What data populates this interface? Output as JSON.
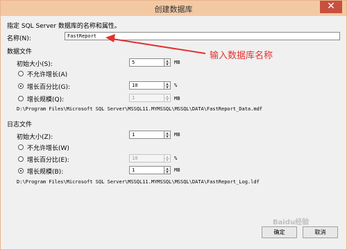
{
  "window": {
    "title": "创建数据库",
    "close_icon": "close-icon"
  },
  "intro": "指定 SQL Server 数据库的名称和属性。",
  "name": {
    "label": "名称(N):",
    "value": "FastReport"
  },
  "data_file": {
    "section_label": "数据文件",
    "initial_size_label": "初始大小(S):",
    "initial_size_value": "5",
    "initial_size_unit": "MB",
    "growth_options": [
      {
        "label": "不允许增长(A)",
        "selected": false
      },
      {
        "label": "增长百分比(G):",
        "selected": true,
        "value": "10",
        "unit": "%"
      },
      {
        "label": "增长规模(Q):",
        "selected": false,
        "value": "1",
        "unit": "MB"
      }
    ],
    "path": "D:\\Program Files\\Microsoft SQL Server\\MSSQL11.MYMSSQL\\MSSQL\\DATA\\FastReport_Data.mdf"
  },
  "log_file": {
    "section_label": "日志文件",
    "initial_size_label": "初始大小(Z):",
    "initial_size_value": "1",
    "initial_size_unit": "MB",
    "growth_options": [
      {
        "label": "不允许增长(W)",
        "selected": false
      },
      {
        "label": "增长百分比(E):",
        "selected": false,
        "value": "10",
        "unit": "%"
      },
      {
        "label": "增长规模(B):",
        "selected": true,
        "value": "1",
        "unit": "MB"
      }
    ],
    "path": "D:\\Program Files\\Microsoft SQL Server\\MSSQL11.MYMSSQL\\MSSQL\\DATA\\FastReport_Log.ldf"
  },
  "buttons": {
    "ok": "确定",
    "cancel": "取消"
  },
  "annotation": "输入数据库名称",
  "watermark": "Baidu经验",
  "colors": {
    "annotation": "#e33131",
    "titlebar": "#f3c9a4",
    "close": "#c7503f"
  }
}
